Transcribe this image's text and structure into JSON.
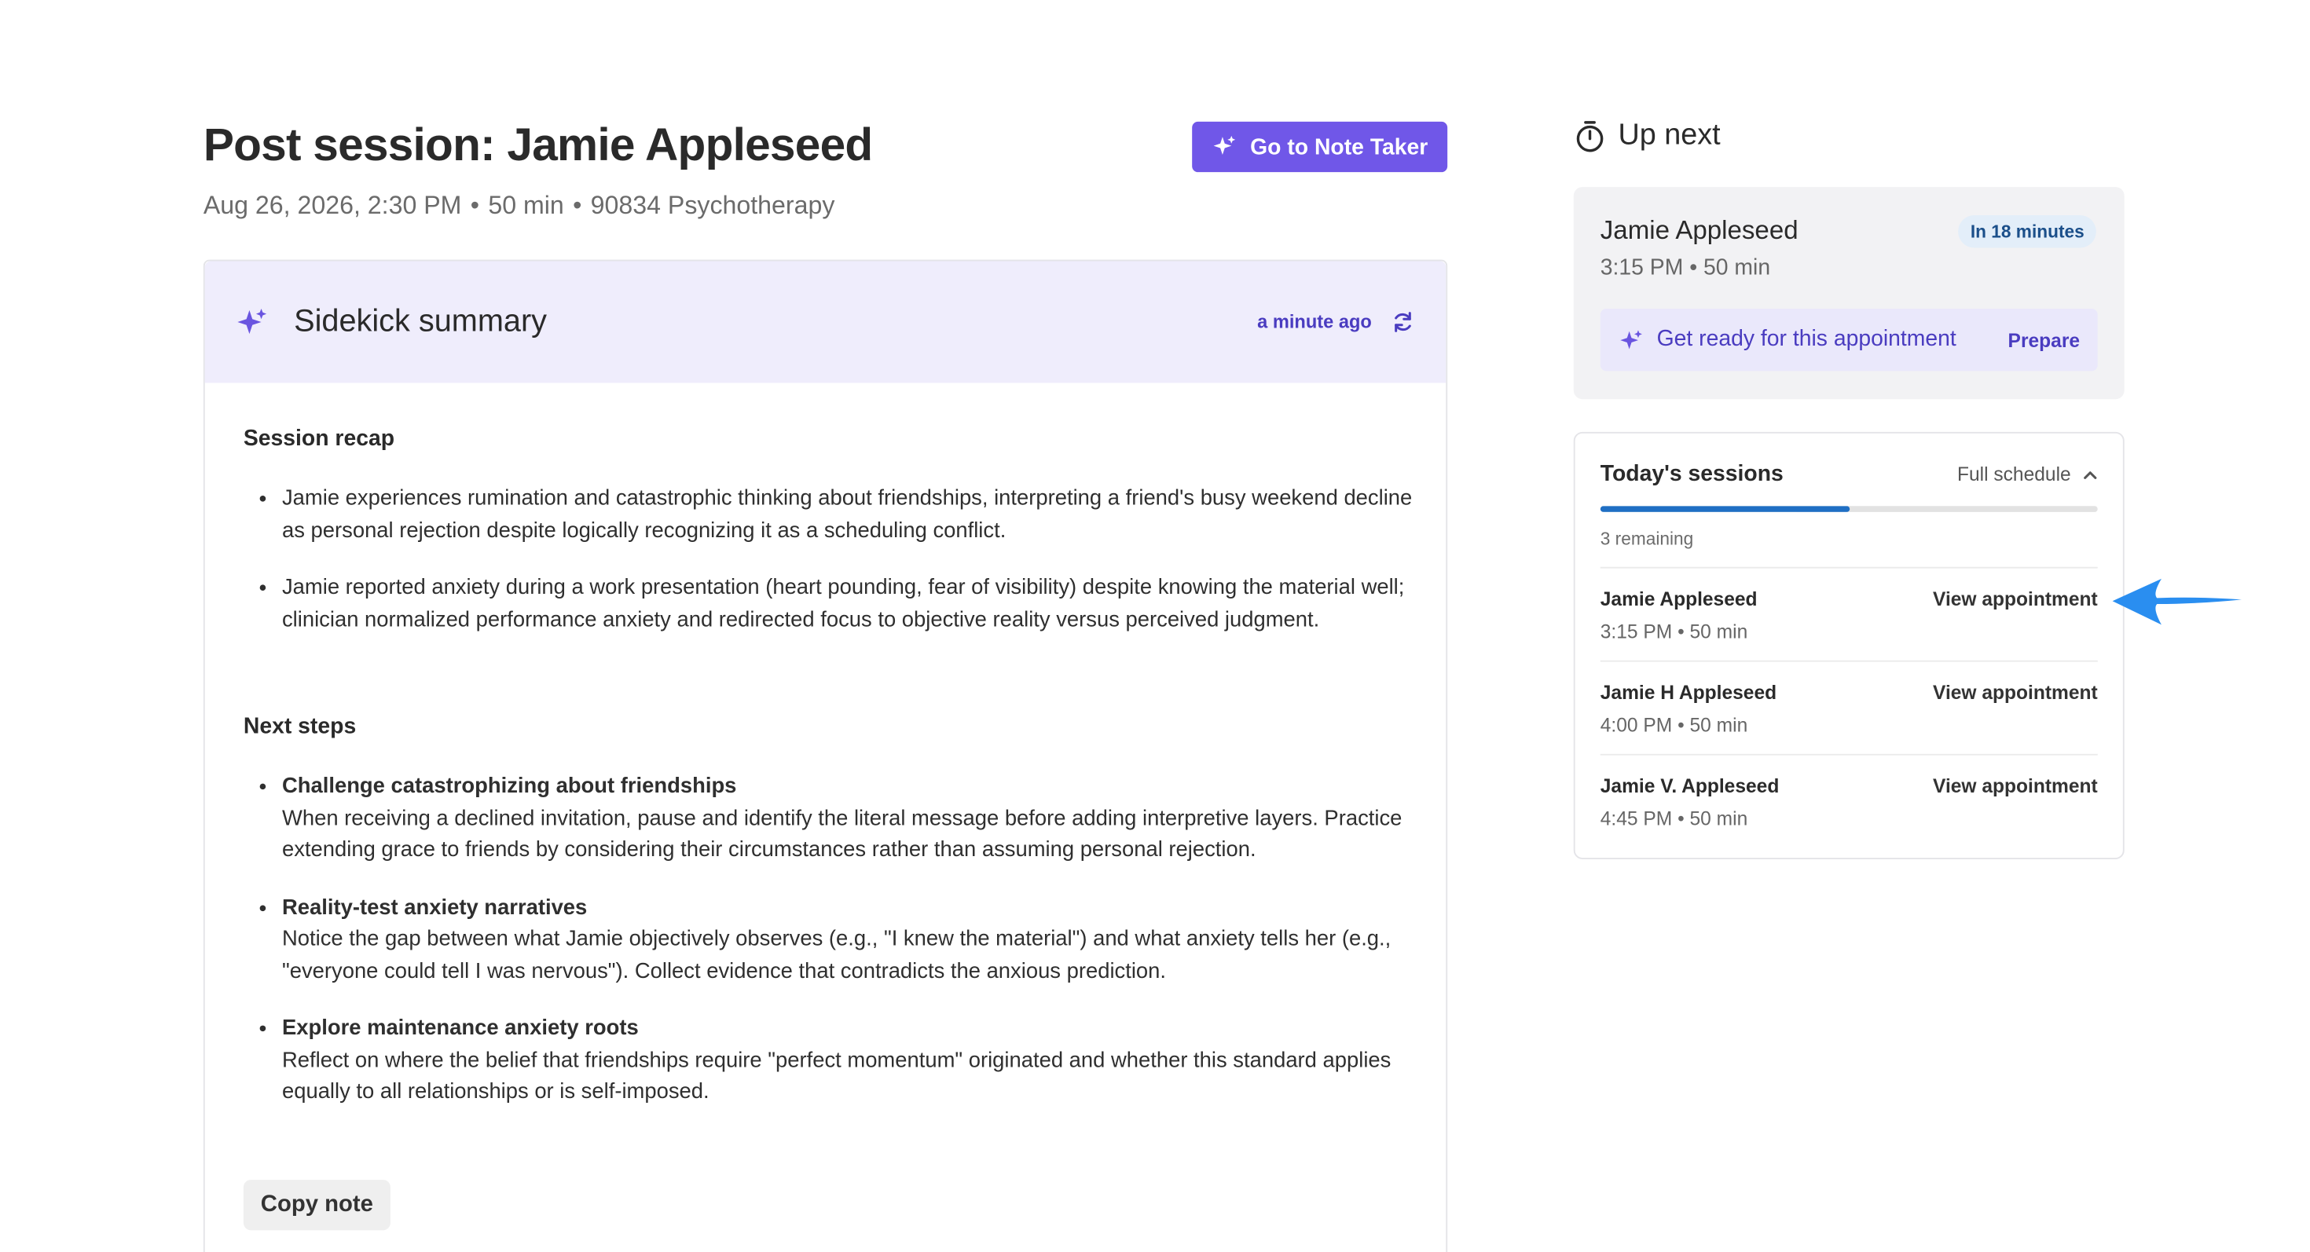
{
  "header": {
    "title": "Post session: Jamie Appleseed",
    "meta": [
      "Aug 26, 2026, 2:30 PM",
      "50 min",
      "90834 Psychotherapy"
    ],
    "note_taker_button": "Go to Note Taker"
  },
  "summary": {
    "title": "Sidekick summary",
    "updated": "a minute ago",
    "recap_heading": "Session recap",
    "recap": [
      "Jamie experiences rumination and catastrophic thinking about friendships, interpreting a friend's busy weekend decline as personal rejection despite logically recognizing it as a scheduling conflict.",
      "Jamie reported anxiety during a work presentation (heart pounding, fear of visibility) despite knowing the material well; clinician normalized performance anxiety and redirected focus to objective reality versus perceived judgment."
    ],
    "next_heading": "Next steps",
    "next_steps": [
      {
        "title": "Challenge catastrophizing about friendships",
        "body": "When receiving a declined invitation, pause and identify the literal message before adding interpretive layers. Practice extending grace to friends by considering their circumstances rather than assuming personal rejection."
      },
      {
        "title": "Reality-test anxiety narratives",
        "body": "Notice the gap between what Jamie objectively observes (e.g., \"I knew the material\") and what anxiety tells her (e.g., \"everyone could tell I was nervous\"). Collect evidence that contradicts the anxious prediction."
      },
      {
        "title": "Explore maintenance anxiety roots",
        "body": "Reflect on where the belief that friendships require \"perfect momentum\" originated and whether this standard applies equally to all relationships or is self-imposed."
      }
    ],
    "copy_button": "Copy note"
  },
  "up_next": {
    "title": "Up next",
    "name": "Jamie Appleseed",
    "time": "3:15 PM",
    "duration": "50 min",
    "badge": "In 18 minutes",
    "prep_text": "Get ready for this appointment",
    "prep_link": "Prepare"
  },
  "sessions": {
    "title": "Today's sessions",
    "full_schedule": "Full schedule",
    "progress_fraction": 0.5,
    "remaining": "3 remaining",
    "items": [
      {
        "name": "Jamie Appleseed",
        "time": "3:15 PM",
        "duration": "50 min",
        "link": "View appointment"
      },
      {
        "name": "Jamie H Appleseed",
        "time": "4:00 PM",
        "duration": "50 min",
        "link": "View appointment"
      },
      {
        "name": "Jamie V. Appleseed",
        "time": "4:45 PM",
        "duration": "50 min",
        "link": "View appointment"
      }
    ]
  },
  "colors": {
    "accent": "#7057e8",
    "accent_text": "#4a3cc0",
    "progress": "#1f6fc4",
    "annotation_arrow": "#2a8ef0"
  }
}
